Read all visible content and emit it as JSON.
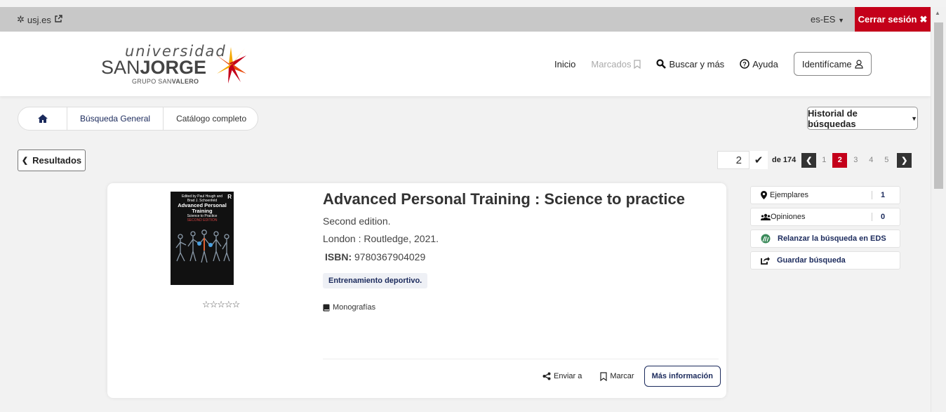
{
  "topbar": {
    "site_label": "usj.es",
    "language": "es-ES",
    "logout_label": "Cerrar sesión"
  },
  "logo": {
    "line1": "universidad",
    "line2a": "SAN",
    "line2b": "JORGE",
    "line3a": "GRUPO SAN",
    "line3b": "VALERO"
  },
  "nav": {
    "home": "Inicio",
    "bookmarks": "Marcados",
    "search": "Buscar y más",
    "help": "Ayuda",
    "login": "Identifícame"
  },
  "breadcrumb": {
    "items": [
      "Búsqueda General",
      "Catálogo completo"
    ]
  },
  "history_button": "Historial de búsquedas",
  "results_button": "Resultados",
  "pager": {
    "current_value": "2",
    "of_text": "de 174",
    "pages": [
      "1",
      "2",
      "3",
      "4",
      "5"
    ],
    "active_page": "2"
  },
  "record": {
    "title": "Advanced Personal Training : Science to practice",
    "edition": "Second edition.",
    "publication": "London : Routledge, 2021.",
    "isbn_label": "ISBN:",
    "isbn_value": "9780367904029",
    "subject_tag": "Entrenamiento deportivo.",
    "format": "Monografías",
    "cover": {
      "editors": "Edited by Paul Hough and Brad J. Schoenfeld",
      "title": "Advanced Personal Training",
      "subtitle": "Science to Practice",
      "edition": "SECOND EDITION",
      "publisher_mark": "R"
    },
    "rating_stars": "☆☆☆☆☆"
  },
  "actions": {
    "send": "Enviar a",
    "mark": "Marcar",
    "more_info": "Más información"
  },
  "side": {
    "copies_label": "Ejemplares",
    "copies_count": "1",
    "reviews_label": "Opiniones",
    "reviews_count": "0",
    "relaunch_label": "Relanzar la búsqueda en EDS",
    "save_label": "Guardar búsqueda"
  },
  "colors": {
    "accent_red": "#c4001a",
    "navy": "#1b2a5c",
    "topbar_gray": "#c8c8c8",
    "background": "#f2f2f2"
  }
}
